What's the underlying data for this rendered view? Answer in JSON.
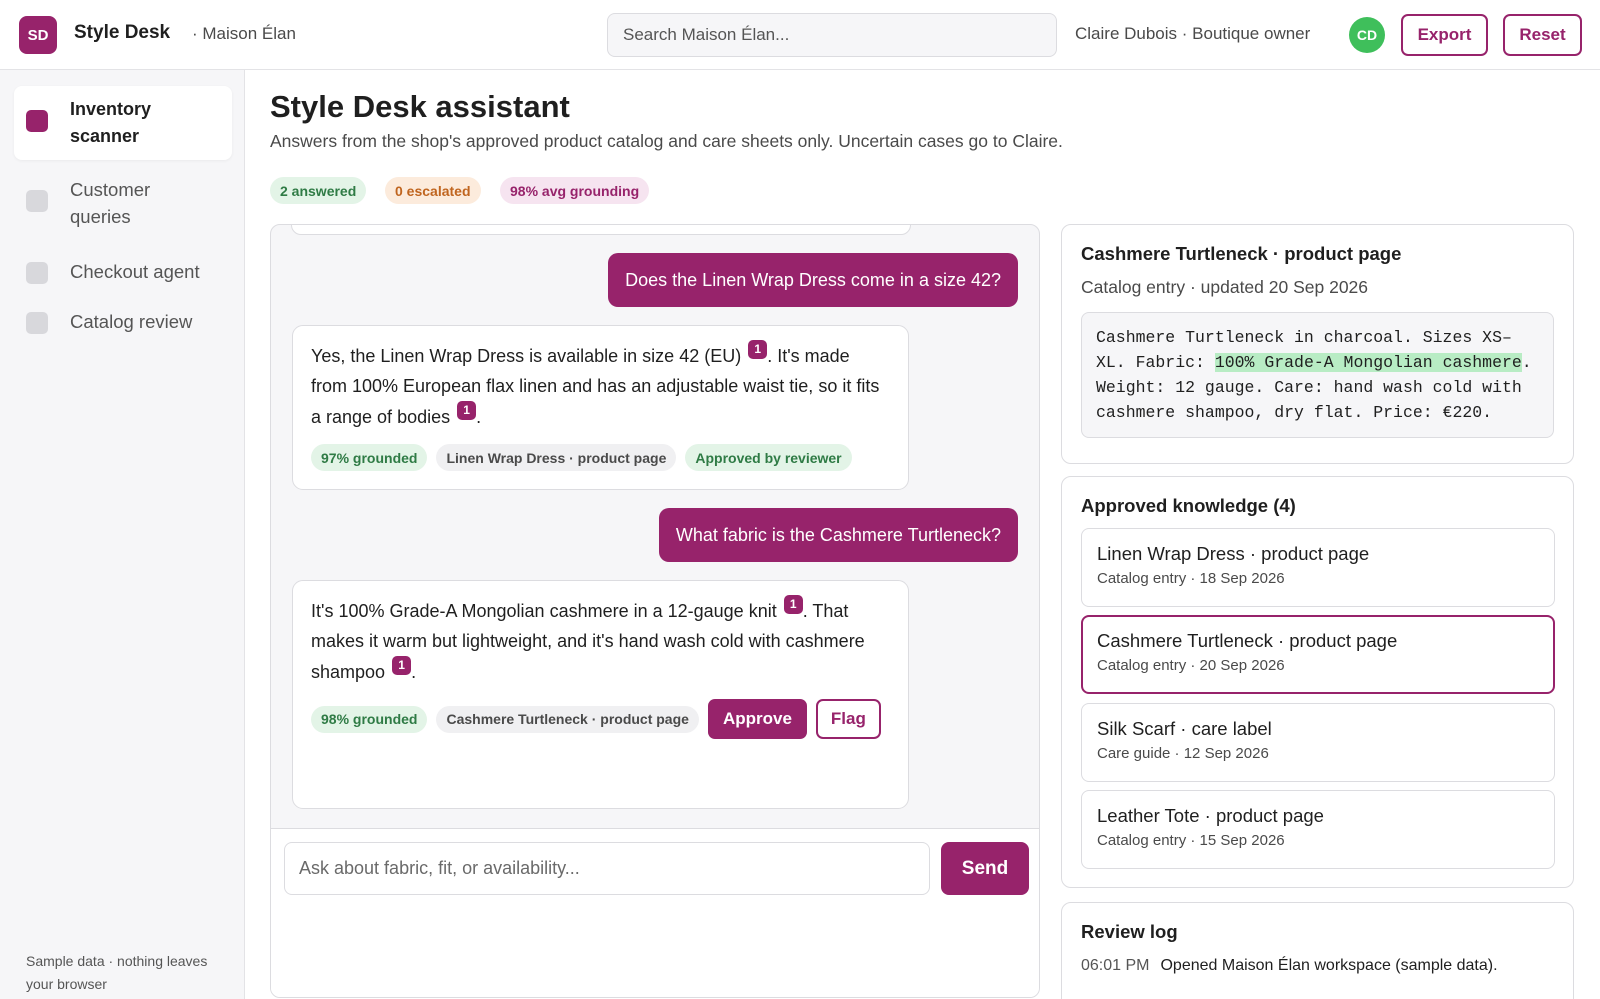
{
  "header": {
    "logo_initials": "SD",
    "app_title": "Style Desk",
    "workspace": "· Maison Élan",
    "search_placeholder": "Search Maison Élan...",
    "user": "Claire Dubois · Boutique owner",
    "avatar_initials": "CD",
    "export_label": "Export",
    "reset_label": "Reset"
  },
  "sidebar": {
    "items": [
      {
        "label": "Inventory scanner",
        "active": true
      },
      {
        "label": "Customer queries",
        "active": false
      },
      {
        "label": "Checkout agent",
        "active": false
      },
      {
        "label": "Catalog review",
        "active": false
      }
    ],
    "footer": "Sample data · nothing leaves your browser"
  },
  "main": {
    "title": "Style Desk assistant",
    "subtitle": "Answers from the shop's approved product catalog and care sheets only. Uncertain cases go to Claire.",
    "stats": {
      "answered": "2 answered",
      "escalated": "0 escalated",
      "grounding": "98% avg grounding"
    }
  },
  "chat": {
    "messages": [
      {
        "question": "Does the Linen Wrap Dress come in a size 42?",
        "answer_parts": [
          "Yes, the Linen Wrap Dress is available in size 42 (EU)",
          ". It's made from 100% European flax linen and has an adjustable waist tie, so it fits a range of bodies",
          "."
        ],
        "citation": "1",
        "grounded": "97% grounded",
        "source": "Linen Wrap Dress · product page",
        "status": "Approved by reviewer"
      },
      {
        "question": "What fabric is the Cashmere Turtleneck?",
        "answer_parts": [
          "It's 100% Grade-A Mongolian cashmere in a 12-gauge knit",
          ". That makes it warm but lightweight, and it's hand wash cold with cashmere shampoo",
          "."
        ],
        "citation": "1",
        "grounded": "98% grounded",
        "source": "Cashmere Turtleneck · product page",
        "approve_label": "Approve",
        "flag_label": "Flag"
      }
    ],
    "input_placeholder": "Ask about fabric, fit, or availability...",
    "send_label": "Send"
  },
  "source_panel": {
    "title": "Cashmere Turtleneck · product page",
    "meta": "Catalog entry · updated 20 Sep 2026",
    "excerpt_before": "Cashmere Turtleneck in charcoal. Sizes XS–XL. Fabric: ",
    "excerpt_highlight": "100% Grade-A Mongolian cashmere",
    "excerpt_after": ". Weight: 12 gauge. Care: hand wash cold with cashmere shampoo, dry flat. Price: €220."
  },
  "knowledge": {
    "title": "Approved knowledge (4)",
    "items": [
      {
        "title": "Linen Wrap Dress · product page",
        "meta": "Catalog entry · 18 Sep 2026",
        "selected": false
      },
      {
        "title": "Cashmere Turtleneck · product page",
        "meta": "Catalog entry · 20 Sep 2026",
        "selected": true
      },
      {
        "title": "Silk Scarf · care label",
        "meta": "Care guide · 12 Sep 2026",
        "selected": false
      },
      {
        "title": "Leather Tote · product page",
        "meta": "Catalog entry · 15 Sep 2026",
        "selected": false
      }
    ]
  },
  "review_log": {
    "title": "Review log",
    "entries": [
      {
        "time": "06:01 PM",
        "text": "Opened Maison Élan workspace (sample data)."
      }
    ]
  },
  "colors": {
    "accent": "#97236b",
    "avatar": "#3fbf5b",
    "grounded_chip": "#e3f4e7",
    "escalated_chip": "#fcebdc",
    "highlight": "#b8ecc4"
  }
}
